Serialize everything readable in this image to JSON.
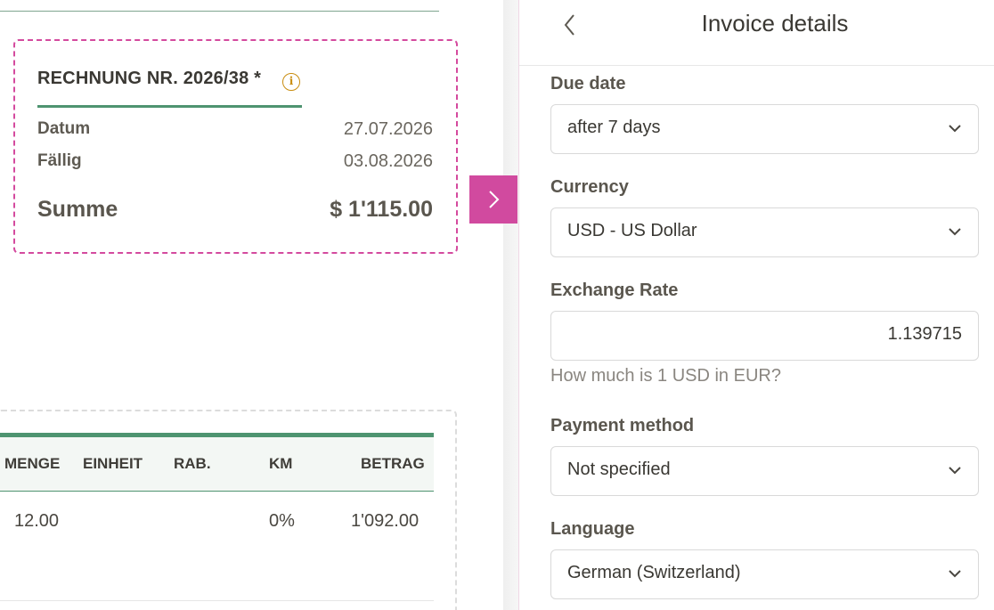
{
  "invoice_card": {
    "title": "RECHNUNG NR. 2026/38 *",
    "rows": [
      {
        "label": "Datum",
        "value": "27.07.2026"
      },
      {
        "label": "Fällig",
        "value": "03.08.2026"
      }
    ],
    "sum_label": "Summe",
    "sum_value": "$ 1'115.00"
  },
  "items_table": {
    "columns": [
      "MENGE",
      "EINHEIT",
      "RAB.",
      "KM",
      "BETRAG"
    ],
    "rows": [
      {
        "menge": "12.00",
        "einheit": "",
        "rab": "",
        "km": "0%",
        "betrag": "1'092.00"
      }
    ]
  },
  "panel": {
    "title": "Invoice details",
    "due_date": {
      "label": "Due date",
      "value": "after 7 days"
    },
    "currency": {
      "label": "Currency",
      "value": "USD - US Dollar"
    },
    "exchange_rate": {
      "label": "Exchange Rate",
      "value": "1.139715",
      "hint": "How much is 1 USD in EUR?"
    },
    "payment_method": {
      "label": "Payment method",
      "value": "Not specified"
    },
    "language": {
      "label": "Language",
      "value": "German (Switzerland)"
    }
  },
  "colors": {
    "accent": "#d14a9f",
    "green": "#4e9470",
    "info": "#c98d10"
  },
  "icons": {
    "info": "info-icon",
    "back": "chevron-left-icon",
    "collapse": "chevron-right-icon",
    "dropdown": "chevron-down-icon"
  }
}
